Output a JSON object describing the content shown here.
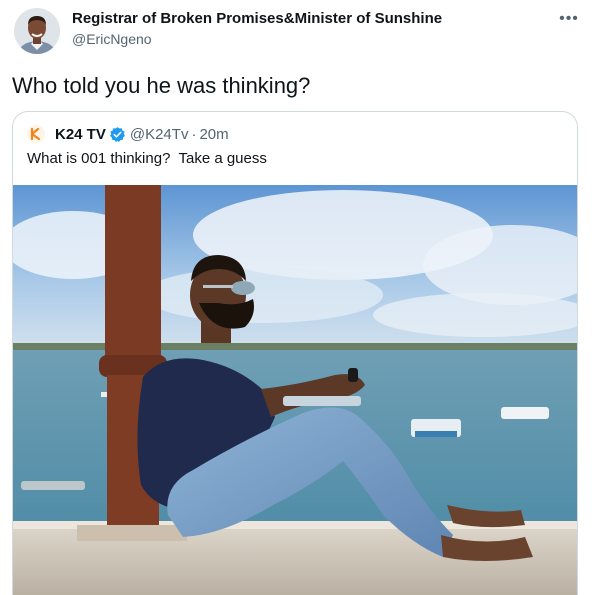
{
  "tweet": {
    "author_name": "Registrar of Broken Promises&Minister of Sunshine",
    "author_handle": "@EricNgeno",
    "text": "Who told you he was thinking?",
    "more_label": "•••"
  },
  "quoted_tweet": {
    "author_name": "K24 TV",
    "author_handle": "@K24Tv",
    "separator": "·",
    "time": "20m",
    "text": "What is 001 thinking?  Take a guess",
    "verified": true
  },
  "colors": {
    "text": "#0f1419",
    "secondary": "#536471",
    "border": "#cfd9de",
    "verified": "#1d9bf0",
    "brand_k24": "#f0841e"
  },
  "icons": {
    "more": "more-horizontal-icon",
    "verified": "verified-badge-icon",
    "k24_logo": "k24-logo-icon"
  }
}
